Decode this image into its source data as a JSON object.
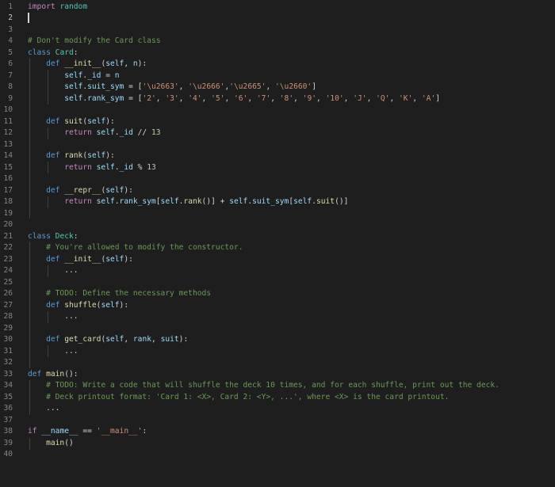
{
  "editor": {
    "language": "python",
    "line_numbers": [
      "1",
      "2",
      "3",
      "4",
      "5",
      "6",
      "7",
      "8",
      "9",
      "10",
      "11",
      "12",
      "13",
      "14",
      "15",
      "16",
      "17",
      "18",
      "19",
      "20",
      "21",
      "22",
      "23",
      "24",
      "25",
      "26",
      "27",
      "28",
      "29",
      "30",
      "31",
      "32",
      "33",
      "34",
      "35",
      "36",
      "37",
      "38",
      "39",
      "40"
    ],
    "active_line": "2",
    "lines": [
      "import random",
      "",
      "",
      "# Don't modify the Card class",
      "class Card:",
      "    def __init__(self, n):",
      "        self._id = n",
      "        self.suit_sym = ['\\u2663', '\\u2666','\\u2665', '\\u2660']",
      "        self.rank_sym = ['2', '3', '4', '5', '6', '7', '8', '9', '10', 'J', 'Q', 'K', 'A']",
      "",
      "    def suit(self):",
      "        return self._id // 13",
      "",
      "    def rank(self):",
      "        return self._id % 13",
      "",
      "    def __repr__(self):",
      "        return self.rank_sym[self.rank()] + self.suit_sym[self.suit()]",
      "",
      "",
      "class Deck:",
      "    # You're allowed to modify the constructor.",
      "    def __init__(self):",
      "        ...",
      "",
      "    # TODO: Define the necessary methods",
      "    def shuffle(self):",
      "        ...",
      "",
      "    def get_card(self, rank, suit):",
      "        ...",
      "",
      "def main():",
      "    # TODO: Write a code that will shuffle the deck 10 times, and for each shuffle, print out the deck.",
      "    # Deck printout format: 'Card 1: <X>, Card 2: <Y>, ...', where <X> is the card printout.",
      "    ...",
      "",
      "if __name__ == '__main__':",
      "    main()",
      ""
    ]
  }
}
